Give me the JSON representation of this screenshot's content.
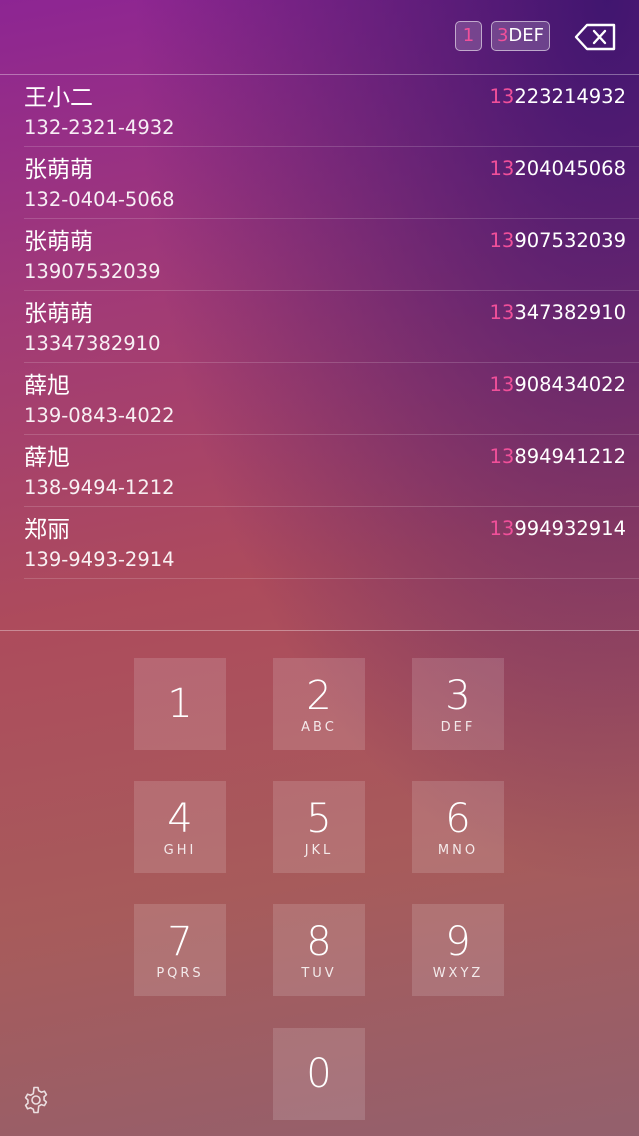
{
  "input": {
    "chip1": "1",
    "chip2_prefix": "3",
    "chip2_rest": "DEF"
  },
  "contacts": [
    {
      "name": "王小二",
      "phone": "132-2321-4932",
      "match_pre": "13",
      "match_rest": "223214932"
    },
    {
      "name": "张萌萌",
      "phone": "132-0404-5068",
      "match_pre": "13",
      "match_rest": "204045068"
    },
    {
      "name": "张萌萌",
      "phone": "13907532039",
      "match_pre": "13",
      "match_rest": "907532039"
    },
    {
      "name": "张萌萌",
      "phone": "13347382910",
      "match_pre": "13",
      "match_rest": "347382910"
    },
    {
      "name": "薛旭",
      "phone": "139-0843-4022",
      "match_pre": "13",
      "match_rest": "908434022"
    },
    {
      "name": "薛旭",
      "phone": "138-9494-1212",
      "match_pre": "13",
      "match_rest": "894941212"
    },
    {
      "name": "郑丽",
      "phone": "139-9493-2914",
      "match_pre": "13",
      "match_rest": "994932914"
    }
  ],
  "keypad": [
    {
      "digit": "1",
      "letters": ""
    },
    {
      "digit": "2",
      "letters": "ABC"
    },
    {
      "digit": "3",
      "letters": "DEF"
    },
    {
      "digit": "4",
      "letters": "GHI"
    },
    {
      "digit": "5",
      "letters": "JKL"
    },
    {
      "digit": "6",
      "letters": "MNO"
    },
    {
      "digit": "7",
      "letters": "PQRS"
    },
    {
      "digit": "8",
      "letters": "TUV"
    },
    {
      "digit": "9",
      "letters": "WXYZ"
    },
    {
      "digit": "0",
      "letters": ""
    }
  ],
  "icons": {
    "backspace": "backspace-icon",
    "settings": "gear-icon"
  },
  "colors": {
    "highlight": "#f0509a"
  }
}
